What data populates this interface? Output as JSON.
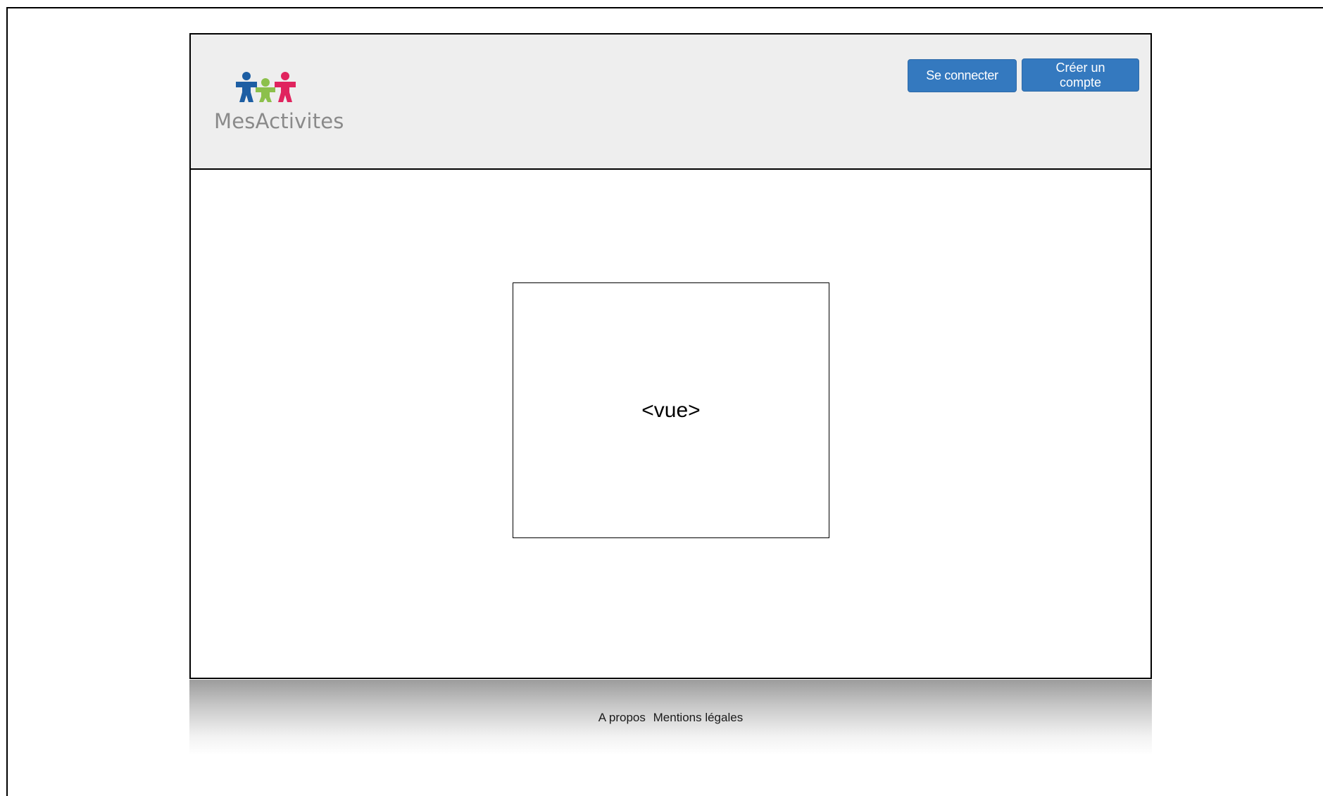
{
  "header": {
    "logo": {
      "text": "MesActivites",
      "icon": "three-puzzle-people-icon",
      "colors": [
        "#1d5ea3",
        "#8cc04b",
        "#e0245e"
      ]
    },
    "buttons": {
      "login_label": "Se connecter",
      "signup_label": "Créer un compte"
    }
  },
  "main": {
    "view_placeholder": "<vue>"
  },
  "footer": {
    "links": [
      "A propos",
      "Mentions légales"
    ]
  },
  "colors": {
    "button": "#3479bf",
    "header_bg": "#eeeeee"
  }
}
